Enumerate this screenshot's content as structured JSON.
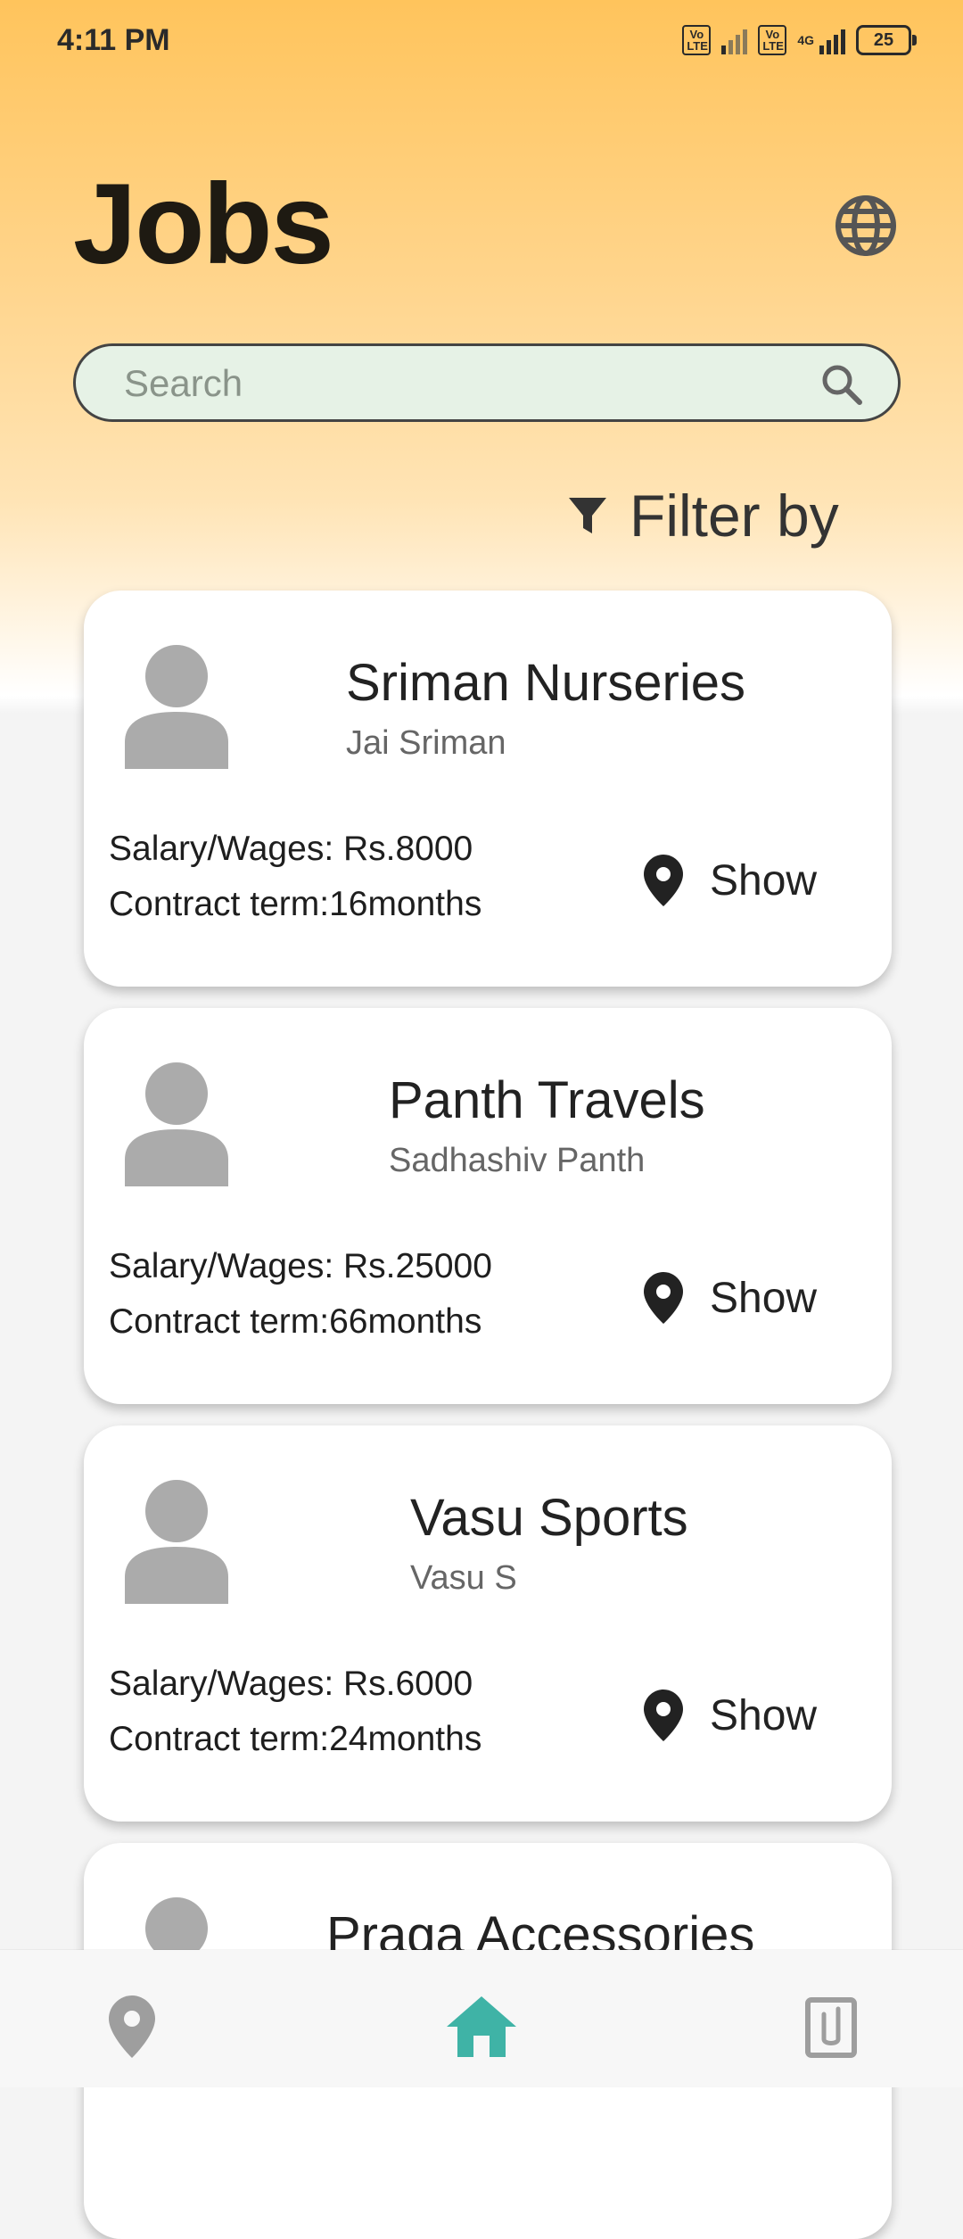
{
  "status_bar": {
    "time": "4:11 PM",
    "sim1": "Vo LTE",
    "sim2": "Vo LTE",
    "network": "4G",
    "battery": "25"
  },
  "header": {
    "title": "Jobs",
    "globe_icon": "globe-icon"
  },
  "search": {
    "placeholder": "Search",
    "value": "",
    "icon": "search-icon"
  },
  "filter": {
    "label": "Filter by",
    "icon": "filter-funnel-icon"
  },
  "jobs": [
    {
      "company": "Sriman Nurseries",
      "owner": "Jai Sriman",
      "salary": "Salary/Wages: Rs.8000",
      "term": "Contract term:16months",
      "show_label": "Show"
    },
    {
      "company": "Panth Travels",
      "owner": "Sadhashiv Panth",
      "salary": "Salary/Wages: Rs.25000",
      "term": "Contract term:66months",
      "show_label": "Show"
    },
    {
      "company": "Vasu Sports",
      "owner": "Vasu S",
      "salary": "Salary/Wages: Rs.6000",
      "term": "Contract term:24months",
      "show_label": "Show"
    },
    {
      "company": "Praga Accessories"
    }
  ],
  "bottom_nav": {
    "items": [
      {
        "icon": "location-pin-icon",
        "active": false
      },
      {
        "icon": "home-icon",
        "active": true
      },
      {
        "icon": "attachment-clipboard-icon",
        "active": false
      }
    ]
  },
  "colors": {
    "header_gradient_top": "#ffc45c",
    "search_bg": "#e6f2e6",
    "active_nav": "#3fb3a6",
    "inactive_nav": "#9e9e9e"
  }
}
